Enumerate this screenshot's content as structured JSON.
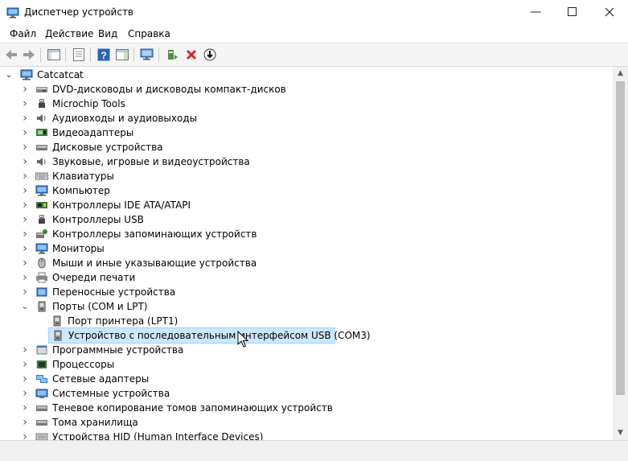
{
  "window": {
    "title": "Диспетчер устройств"
  },
  "menu": {
    "file": "Файл",
    "action": "Действие",
    "view": "Вид",
    "help": "Справка"
  },
  "tree": {
    "root": "Catcatcat",
    "items": [
      {
        "label": "DVD-дисководы и дисководы компакт-дисков",
        "icon": "dvd-icon"
      },
      {
        "label": "Microchip Tools",
        "icon": "usb-plug-icon"
      },
      {
        "label": "Аудиовходы и аудиовыходы",
        "icon": "speaker-icon"
      },
      {
        "label": "Видеоадаптеры",
        "icon": "display-adapter-icon"
      },
      {
        "label": "Дисковые устройства",
        "icon": "disk-drive-icon"
      },
      {
        "label": "Звуковые, игровые и видеоустройства",
        "icon": "speaker-icon"
      },
      {
        "label": "Клавиатуры",
        "icon": "keyboard-icon"
      },
      {
        "label": "Компьютер",
        "icon": "computer-icon"
      },
      {
        "label": "Контроллеры IDE ATA/ATAPI",
        "icon": "ide-controller-icon"
      },
      {
        "label": "Контроллеры USB",
        "icon": "usb-plug-icon"
      },
      {
        "label": "Контроллеры запоминающих устройств",
        "icon": "storage-controller-icon"
      },
      {
        "label": "Мониторы",
        "icon": "monitor-icon"
      },
      {
        "label": "Мыши и иные указывающие устройства",
        "icon": "mouse-icon"
      },
      {
        "label": "Очереди печати",
        "icon": "printer-icon"
      },
      {
        "label": "Переносные устройства",
        "icon": "portable-device-icon"
      },
      {
        "label": "Порты (COM и LPT)",
        "icon": "port-icon",
        "expanded": true,
        "children": [
          {
            "label": "Порт принтера (LPT1)",
            "icon": "port-icon"
          },
          {
            "label": "Устройство с последовательным интерфейсом USB (COM3)",
            "icon": "port-icon",
            "selected": true
          }
        ]
      },
      {
        "label": "Программные устройства",
        "icon": "software-device-icon"
      },
      {
        "label": "Процессоры",
        "icon": "processor-icon"
      },
      {
        "label": "Сетевые адаптеры",
        "icon": "network-adapter-icon"
      },
      {
        "label": "Системные устройства",
        "icon": "system-device-icon"
      },
      {
        "label": "Теневое копирование томов запоминающих устройств",
        "icon": "disk-drive-icon"
      },
      {
        "label": "Тома хранилища",
        "icon": "disk-drive-icon"
      },
      {
        "label": "Устройства HID (Human Interface Devices)",
        "icon": "hid-icon"
      }
    ]
  },
  "colors": {
    "selection": "#cce8ff",
    "selection_border": "#99d1ff",
    "delete_red": "#d9232e",
    "toolbar_bg": "#f5f5f5"
  }
}
